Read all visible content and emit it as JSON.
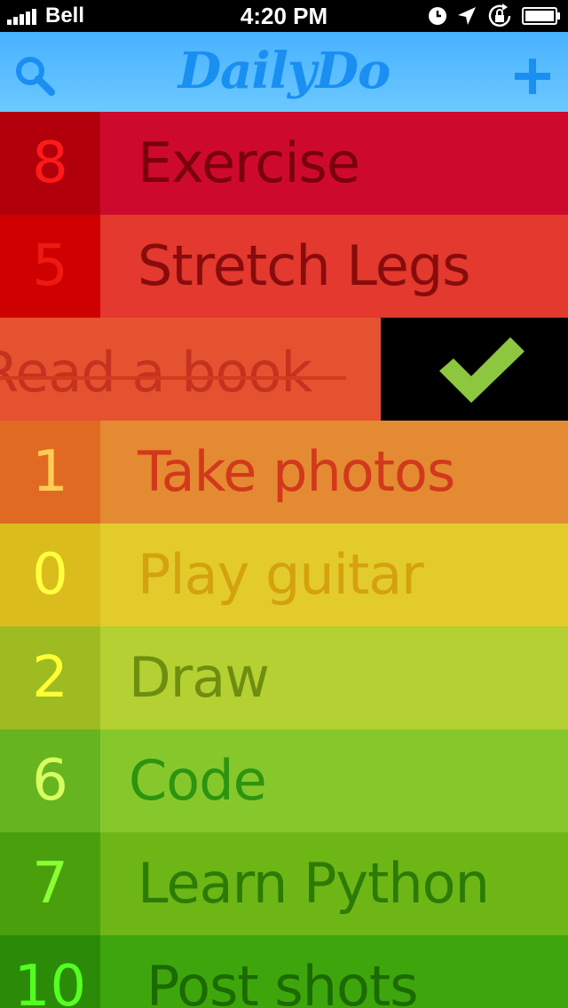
{
  "status_bar": {
    "carrier": "Bell",
    "time": "4:20 PM",
    "icons": [
      "signal-bars-icon",
      "clock-icon",
      "location-arrow-icon",
      "rotation-lock-icon",
      "battery-icon"
    ]
  },
  "navbar": {
    "title": "DailyDo",
    "left_icon": "search-icon",
    "right_icon": "plus-icon"
  },
  "tasks": [
    {
      "count": "8",
      "label": "Exercise",
      "num_bg": "#b1000b",
      "label_bg": "#cd0a2e",
      "num_color": "#ff1a1a",
      "label_color": "#7a0010"
    },
    {
      "count": "5",
      "label": "Stretch Legs",
      "num_bg": "#cf0000",
      "label_bg": "#e3392e",
      "num_color": "#ee1a12",
      "label_color": "#880c0c"
    },
    {
      "count": "1",
      "label": "Take photos",
      "num_bg": "#e06a22",
      "label_bg": "#e48a32",
      "num_color": "#ffcc55",
      "label_color": "#d2391c"
    },
    {
      "count": "0",
      "label": "Play guitar",
      "num_bg": "#dbbc1d",
      "label_bg": "#e3cb2c",
      "num_color": "#ffff40",
      "label_color": "#d4a20e"
    },
    {
      "count": "2",
      "label": "Draw",
      "num_bg": "#9ebb22",
      "label_bg": "#b5d033",
      "num_color": "#ffff33",
      "label_color": "#6e8e10"
    },
    {
      "count": "6",
      "label": "Code",
      "num_bg": "#66b41f",
      "label_bg": "#86c82c",
      "num_color": "#d8ff60",
      "label_color": "#2d9410"
    },
    {
      "count": "7",
      "label": "Learn Python",
      "num_bg": "#4a9f0c",
      "label_bg": "#6db616",
      "num_color": "#88ff33",
      "label_color": "#2b7b05"
    },
    {
      "count": "10",
      "label": "Post shots",
      "num_bg": "#2b8b08",
      "label_bg": "#3ea60c",
      "num_color": "#55ff22",
      "label_color": "#1b6a02"
    }
  ],
  "completed_task": {
    "label": "Read a book",
    "state": "swiped-complete",
    "action_icon": "checkmark-icon",
    "check_color": "#8dc63f"
  }
}
